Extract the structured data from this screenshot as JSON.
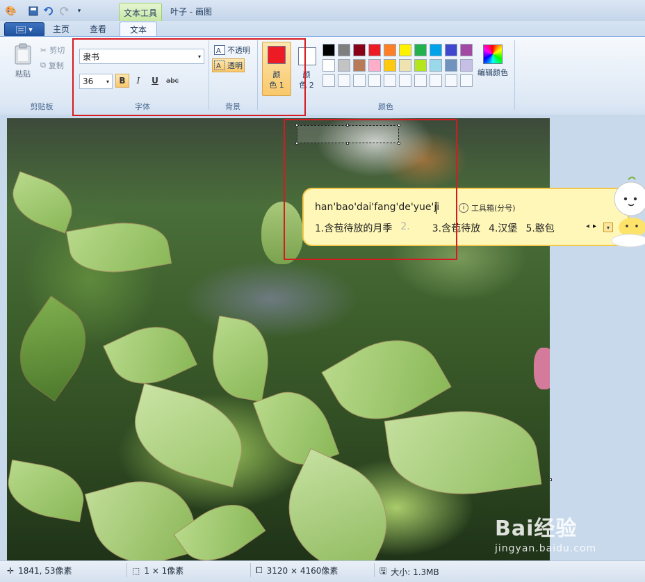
{
  "titlebar": {
    "context_tab": "文本工具",
    "title": "叶子 - 画图"
  },
  "tabs": {
    "home": "主页",
    "view": "查看",
    "text": "文本"
  },
  "clipboard": {
    "paste": "粘贴",
    "cut": "剪切",
    "copy": "复制",
    "group": "剪贴板"
  },
  "font": {
    "family": "隶书",
    "size": "36",
    "bold": "B",
    "italic": "I",
    "underline": "U",
    "strike": "abc",
    "group": "字体"
  },
  "background": {
    "opaque": "不透明",
    "transparent": "透明",
    "group": "背景"
  },
  "colors": {
    "color1_top": "颜",
    "color1_bottom": "色 1",
    "color2_top": "颜",
    "color2_bottom": "色 2",
    "edit_colors": "编辑颜色",
    "group": "颜色",
    "color1_value": "#ed1c24",
    "palette_row1": [
      "#000000",
      "#7f7f7f",
      "#880015",
      "#ed1c24",
      "#ff7f27",
      "#fff200",
      "#22b14c",
      "#00a2e8",
      "#3f48cc",
      "#a349a4"
    ],
    "palette_row2": [
      "#ffffff",
      "#c3c3c3",
      "#b97a57",
      "#ffaec9",
      "#ffc90e",
      "#efe4b0",
      "#b5e61d",
      "#99d9ea",
      "#7092be",
      "#c8bfe7"
    ]
  },
  "ime": {
    "pinyin": "han'bao'dai'fang'de'yue'ji",
    "toolbox": "工具箱(分号)",
    "candidates": [
      "1.含苞待放的月季",
      "2.",
      "3.含苞待放",
      "4.汉堡",
      "5.憨包"
    ]
  },
  "status": {
    "cursor": "1841, 53像素",
    "selection": "1 × 1像素",
    "image_size": "3120 × 4160像素",
    "file_size": "大小: 1.3MB"
  },
  "watermark": {
    "main": "Bai经验",
    "sub": "jingyan.baidu.com"
  }
}
